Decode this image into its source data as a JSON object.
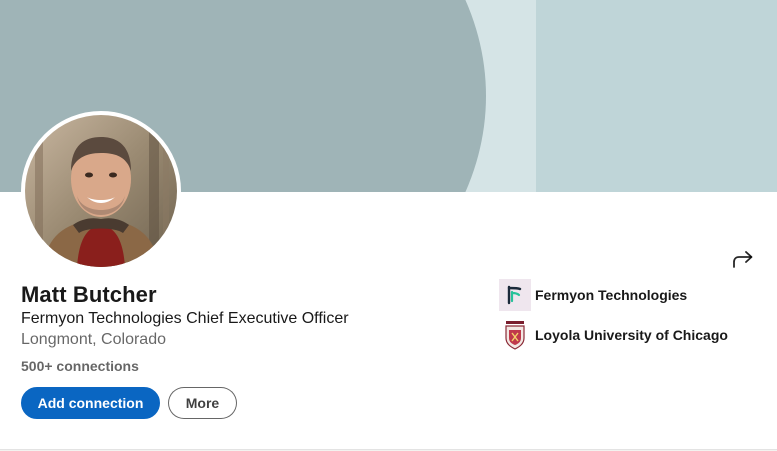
{
  "profile": {
    "name": "Matt Butcher",
    "headline": "Fermyon Technologies Chief Executive Officer",
    "location": "Longmont, Colorado",
    "connections": "500+ connections"
  },
  "actions": {
    "primary_label": "Add connection",
    "secondary_label": "More",
    "share_icon": "share-arrow-icon"
  },
  "organizations": [
    {
      "name": "Fermyon Technologies",
      "logo": "fermyon-logo"
    },
    {
      "name": "Loyola University of Chicago",
      "logo": "loyola-crest"
    }
  ],
  "colors": {
    "accent": "#0a66c2",
    "cover_light": "#bfd5d8",
    "cover_dark": "#9fb4b7"
  }
}
